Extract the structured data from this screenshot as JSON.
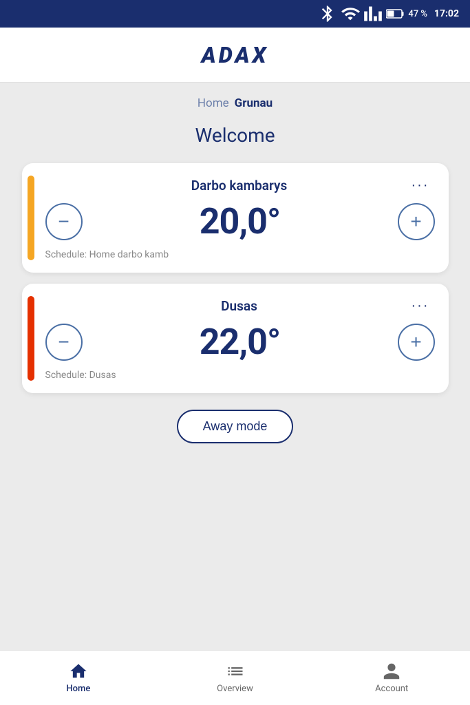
{
  "statusBar": {
    "battery": "47 %",
    "time": "17:02"
  },
  "header": {
    "logo": "ADAX"
  },
  "breadcrumb": {
    "home": "Home",
    "current": "Grunau"
  },
  "welcome": {
    "title": "Welcome"
  },
  "devices": [
    {
      "id": "darbo",
      "name": "Darbo kambarys",
      "temperature": "20,0°",
      "schedule": "Schedule: Home darbo kamb",
      "accentColor": "yellow"
    },
    {
      "id": "dusas",
      "name": "Dusas",
      "temperature": "22,0°",
      "schedule": "Schedule: Dusas",
      "accentColor": "red"
    }
  ],
  "awayMode": {
    "label": "Away mode"
  },
  "bottomNav": {
    "items": [
      {
        "id": "home",
        "label": "Home",
        "active": true
      },
      {
        "id": "overview",
        "label": "Overview",
        "active": false
      },
      {
        "id": "account",
        "label": "Account",
        "active": false
      }
    ]
  }
}
